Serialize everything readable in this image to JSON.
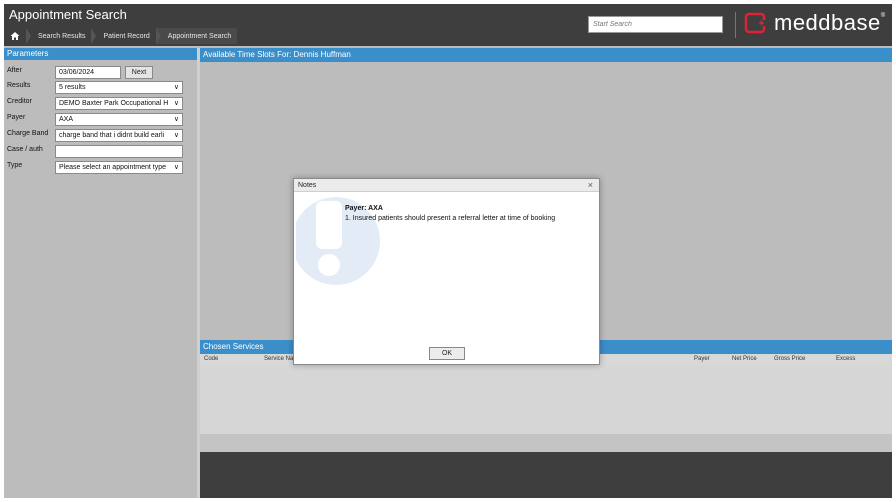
{
  "header": {
    "title": "Appointment Search",
    "breadcrumbs": [
      "Search Results",
      "Patient Record",
      "Appointment Search"
    ],
    "search_placeholder": "Start Search",
    "logo_text": "meddbase",
    "logo_mark": "®"
  },
  "parameters": {
    "title": "Parameters",
    "after_label": "After",
    "after_value": "03/06/2024",
    "next_label": "Next",
    "results_label": "Results",
    "results_value": "5 results",
    "creditor_label": "Creditor",
    "creditor_value": "DEMO Baxter Park Occupational H",
    "payer_label": "Payer",
    "payer_value": "AXA",
    "charge_band_label": "Charge Band",
    "charge_band_value": "charge band that i didnt build earli",
    "case_label": "Case / auth",
    "case_value": "",
    "type_label": "Type",
    "type_value": "Please select an appointment type"
  },
  "slots": {
    "title": "Available Time Slots For: Dennis Huffman"
  },
  "services": {
    "title": "Chosen Services",
    "columns": [
      "Code",
      "Service Na",
      "Payer",
      "Net Price",
      "Gross Price",
      "Excess"
    ]
  },
  "modal": {
    "title": "Notes",
    "close": "×",
    "heading": "Payer: AXA",
    "text": "1. Insured patients should present a referral letter at time of booking",
    "ok": "OK"
  },
  "colors": {
    "accent": "#3a8fcb",
    "header_bg": "#3e3e3e",
    "logo_red": "#e0213a"
  },
  "icons": [
    "home-icon",
    "chevron-down-icon",
    "close-icon",
    "info-watermark-icon",
    "meddbase-logo-icon"
  ]
}
